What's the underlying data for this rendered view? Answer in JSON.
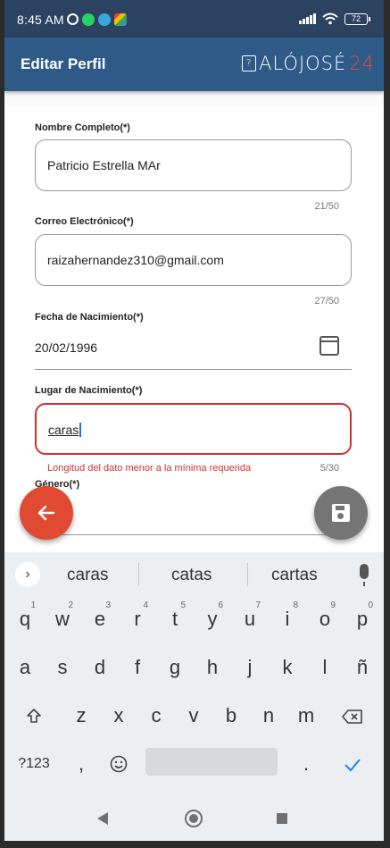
{
  "status_bar": {
    "time": "8:45 AM",
    "battery": "72",
    "icons": [
      "alarm-icon",
      "whatsapp-icon",
      "telegram-icon",
      "photos-icon",
      "signal-icon",
      "wifi-icon",
      "battery-icon"
    ]
  },
  "app_bar": {
    "title": "Editar Perfil",
    "logo_text": "ALÓJOSÉ",
    "logo_num": "24"
  },
  "form": {
    "nombre": {
      "label": "Nombre Completo(*)",
      "value": "Patricio Estrella MAr",
      "counter": "21/50"
    },
    "correo": {
      "label": "Correo Electrónico(*)",
      "value": "raizahernandez310@gmail.com",
      "counter": "27/50"
    },
    "fecha": {
      "label": "Fecha de Nacimiento(*)",
      "value": "20/02/1996"
    },
    "lugar": {
      "label": "Lugar de Nacimiento(*)",
      "value": "caras",
      "error": "Longitud del dato menor a la mínima requerida",
      "counter": "5/30"
    },
    "genero": {
      "label": "Género(*)"
    }
  },
  "keyboard": {
    "suggestions": [
      "caras",
      "catas",
      "cartas"
    ],
    "row1": [
      [
        "q",
        "1"
      ],
      [
        "w",
        "2"
      ],
      [
        "e",
        "3"
      ],
      [
        "r",
        "4"
      ],
      [
        "t",
        "5"
      ],
      [
        "y",
        "6"
      ],
      [
        "u",
        "7"
      ],
      [
        "i",
        "8"
      ],
      [
        "o",
        "9"
      ],
      [
        "p",
        "0"
      ]
    ],
    "row2": [
      "a",
      "s",
      "d",
      "f",
      "g",
      "h",
      "j",
      "k",
      "l",
      "ñ"
    ],
    "row3": [
      "z",
      "x",
      "c",
      "v",
      "b",
      "n",
      "m"
    ],
    "symbols_key": "?123",
    "comma_key": ",",
    "period_key": "."
  },
  "colors": {
    "app_bar": "#2e5a88",
    "status_bar": "#2b4261",
    "error": "#d32f2f",
    "back_fab": "#e04a33",
    "save_fab": "#757575"
  }
}
